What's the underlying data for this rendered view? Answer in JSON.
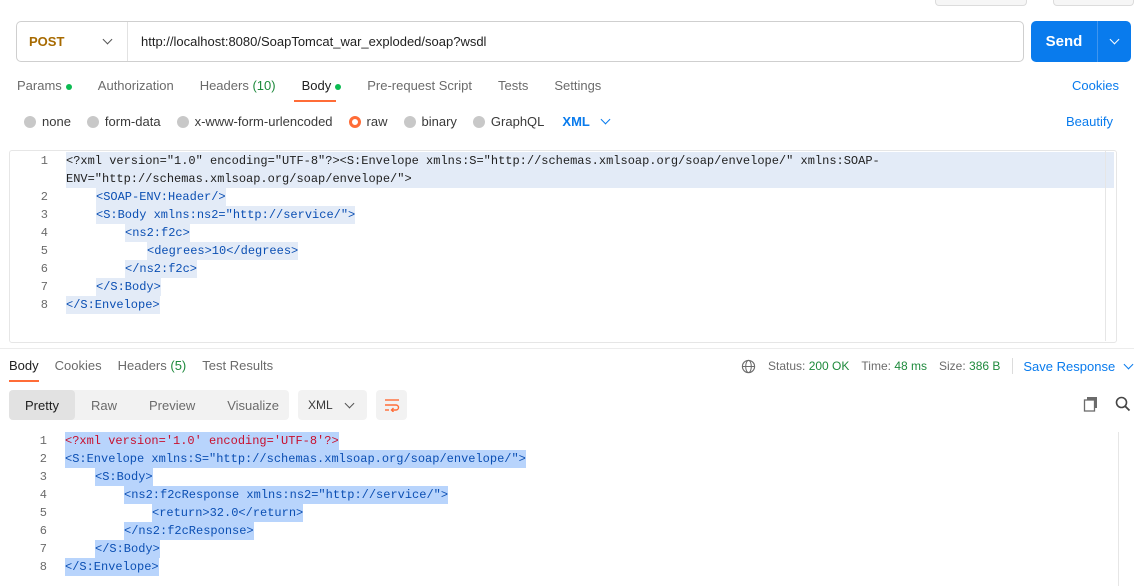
{
  "request": {
    "method": "POST",
    "url": "http://localhost:8080/SoapTomcat_war_exploded/soap?wsdl",
    "send_label": "Send"
  },
  "request_tabs": {
    "params": "Params",
    "authorization": "Authorization",
    "headers": "Headers",
    "headers_count": "(10)",
    "body": "Body",
    "pre_request": "Pre-request Script",
    "tests": "Tests",
    "settings": "Settings",
    "cookies": "Cookies"
  },
  "body_types": {
    "none": "none",
    "form_data": "form-data",
    "urlencoded": "x-www-form-urlencoded",
    "raw": "raw",
    "binary": "binary",
    "graphql": "GraphQL",
    "language": "XML",
    "beautify": "Beautify"
  },
  "request_body": {
    "line_numbers": [
      "1",
      "2",
      "3",
      "4",
      "5",
      "6",
      "7",
      "8"
    ],
    "lines": [
      "<?xml version=\"1.0\" encoding=\"UTF-8\"?><S:Envelope xmlns:S=\"http://schemas.xmlsoap.org/soap/envelope/\" xmlns:SOAP-ENV=\"http://schemas.xmlsoap.org/soap/envelope/\">",
      "<SOAP-ENV:Header/>",
      "<S:Body xmlns:ns2=\"http://service/\">",
      "<ns2:f2c>",
      "<degrees>10</degrees>",
      "</ns2:f2c>",
      "</S:Body>",
      "</S:Envelope>"
    ]
  },
  "response_tabs": {
    "body": "Body",
    "cookies": "Cookies",
    "headers": "Headers",
    "headers_count": "(5)",
    "test_results": "Test Results"
  },
  "response_status": {
    "status_label": "Status:",
    "status_value": "200 OK",
    "time_label": "Time:",
    "time_value": "48 ms",
    "size_label": "Size:",
    "size_value": "386 B",
    "save_response": "Save Response"
  },
  "response_view": {
    "pretty": "Pretty",
    "raw": "Raw",
    "preview": "Preview",
    "visualize": "Visualize",
    "format": "XML"
  },
  "response_body": {
    "line_numbers": [
      "1",
      "2",
      "3",
      "4",
      "5",
      "6",
      "7",
      "8"
    ],
    "lines": [
      "<?xml version='1.0' encoding='UTF-8'?>",
      "<S:Envelope xmlns:S=\"http://schemas.xmlsoap.org/soap/envelope/\">",
      "<S:Body>",
      "<ns2:f2cResponse xmlns:ns2=\"http://service/\">",
      "<return>32.0</return>",
      "</ns2:f2cResponse>",
      "</S:Body>",
      "</S:Envelope>"
    ]
  },
  "colors": {
    "accent": "#097bed",
    "method": "#a76a00",
    "active_tab": "#ff6c37",
    "success": "#1e8a3c"
  }
}
